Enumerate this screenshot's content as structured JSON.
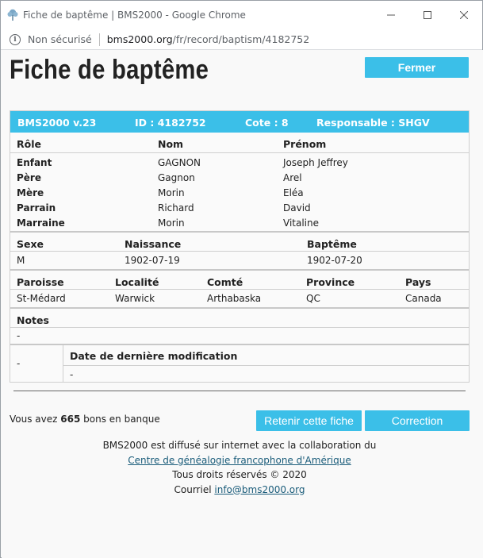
{
  "browser": {
    "tab_title": "Fiche de baptême | BMS2000 - Google Chrome",
    "security_label": "Non sécurisé",
    "url_host": "bms2000.org",
    "url_path": "/fr/record/baptism/4182752",
    "controls": {
      "minimize": "–",
      "maximize": "☐",
      "close": "✕"
    }
  },
  "page": {
    "title": "Fiche de baptême",
    "close_button": "Fermer"
  },
  "record": {
    "header": {
      "version": "BMS2000 v.23",
      "id": "ID : 4182752",
      "cote": "Cote : 8",
      "responsable": "Responsable : SHGV"
    },
    "people_headers": [
      "Rôle",
      "Nom",
      "Prénom"
    ],
    "people": [
      {
        "role": "Enfant",
        "nom": "GAGNON",
        "prenom": "Joseph Jeffrey"
      },
      {
        "role": "Père",
        "nom": "Gagnon",
        "prenom": "Arel"
      },
      {
        "role": "Mère",
        "nom": "Morin",
        "prenom": "Eléa"
      },
      {
        "role": "Parrain",
        "nom": "Richard",
        "prenom": "David"
      },
      {
        "role": "Marraine",
        "nom": "Morin",
        "prenom": "Vitaline"
      }
    ],
    "event_headers": [
      "Sexe",
      "Naissance",
      "Baptême"
    ],
    "event": {
      "sexe": "M",
      "naissance": "1902-07-19",
      "bapteme": "1902-07-20"
    },
    "place_headers": [
      "Paroisse",
      "Localité",
      "Comté",
      "Province",
      "Pays"
    ],
    "place": {
      "paroisse": "St-Médard",
      "localite": "Warwick",
      "comte": "Arthabaska",
      "province": "QC",
      "pays": "Canada"
    },
    "notes_header": "Notes",
    "notes": "-",
    "modified_left": "-",
    "modified_header": "Date de dernière modification",
    "modified_value": "-"
  },
  "footer": {
    "bank_prefix": "Vous avez",
    "bank_count": "665",
    "bank_suffix": "bons en banque",
    "keep_button": "Retenir cette fiche",
    "correction_button": "Correction",
    "credit_line1": "BMS2000 est diffusé sur internet avec la collaboration du",
    "credit_link": "Centre de généalogie francophone d'Amérique",
    "rights": "Tous droits réservés © 2020",
    "email_prefix": "Courriel",
    "email": "info@bms2000.org"
  },
  "colors": {
    "accent": "#3bbfe8"
  }
}
